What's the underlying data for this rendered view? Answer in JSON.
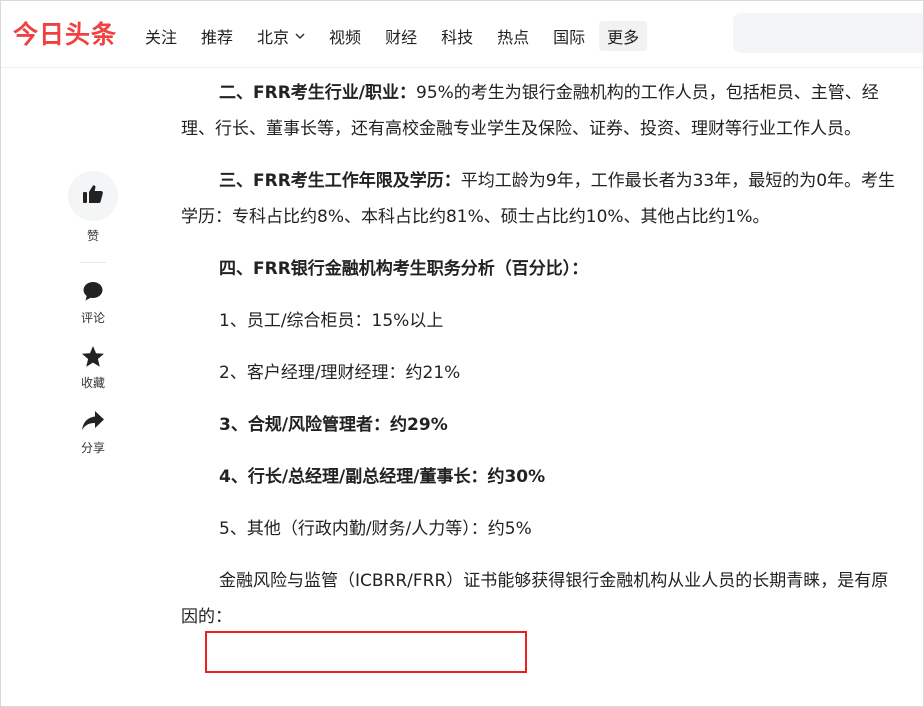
{
  "header": {
    "logo": "今日头条",
    "nav": [
      "关注",
      "推荐",
      "北京",
      "视频",
      "财经",
      "科技",
      "热点",
      "国际"
    ],
    "more": "更多"
  },
  "rail": {
    "like_label": "赞",
    "comment_label": "评论",
    "favorite_label": "收藏",
    "share_label": "分享"
  },
  "article": {
    "p2_title": "二、FRR考生行业/职业：",
    "p2_text": "95%的考生为银行金融机构的工作人员，包括柜员、主管、经理、行长、董事长等，还有高校金融专业学生及保险、证券、投资、理财等行业工作人员。",
    "p3_title": "三、FRR考生工作年限及学历：",
    "p3_text": "平均工龄为9年，工作最长者为33年，最短的为0年。考生学历：专科占比约8%、本科占比约81%、硕士占比约10%、其他占比约1%。",
    "p4_title": "四、FRR银行金融机构考生职务分析（百分比）：",
    "items": [
      "1、员工/综合柜员：15%以上",
      "2、客户经理/理财经理：约21%",
      "3、合规/风险管理者：约29%",
      "4、行长/总经理/副总经理/董事长：约30%",
      "5、其他（行政内勤/财务/人力等）：约5%"
    ],
    "last_highlight": "金融风险与监管（ICBRR/FRR）证书",
    "last_rest": "能够获得银行金融机构从业人员的长期青睐，是有原因的："
  },
  "colors": {
    "brand": "#f04142",
    "highlight_box": "#e8231f"
  }
}
